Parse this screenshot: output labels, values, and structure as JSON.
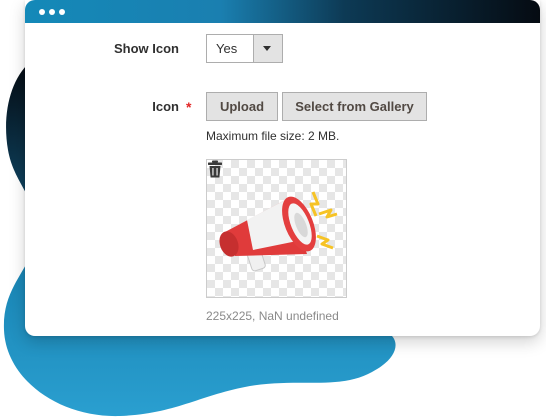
{
  "form": {
    "show_icon": {
      "label": "Show Icon",
      "value": "Yes"
    },
    "icon": {
      "label": "Icon",
      "required_marker": "*",
      "upload_label": "Upload",
      "gallery_label": "Select from Gallery",
      "max_size_note": "Maximum file size: 2 MB.",
      "image_meta": "225x225, NaN undefined",
      "image_icon": "megaphone-icon"
    }
  },
  "colors": {
    "accent_blue": "#1489b8",
    "dark": "#050b12",
    "required": "#e22626"
  }
}
